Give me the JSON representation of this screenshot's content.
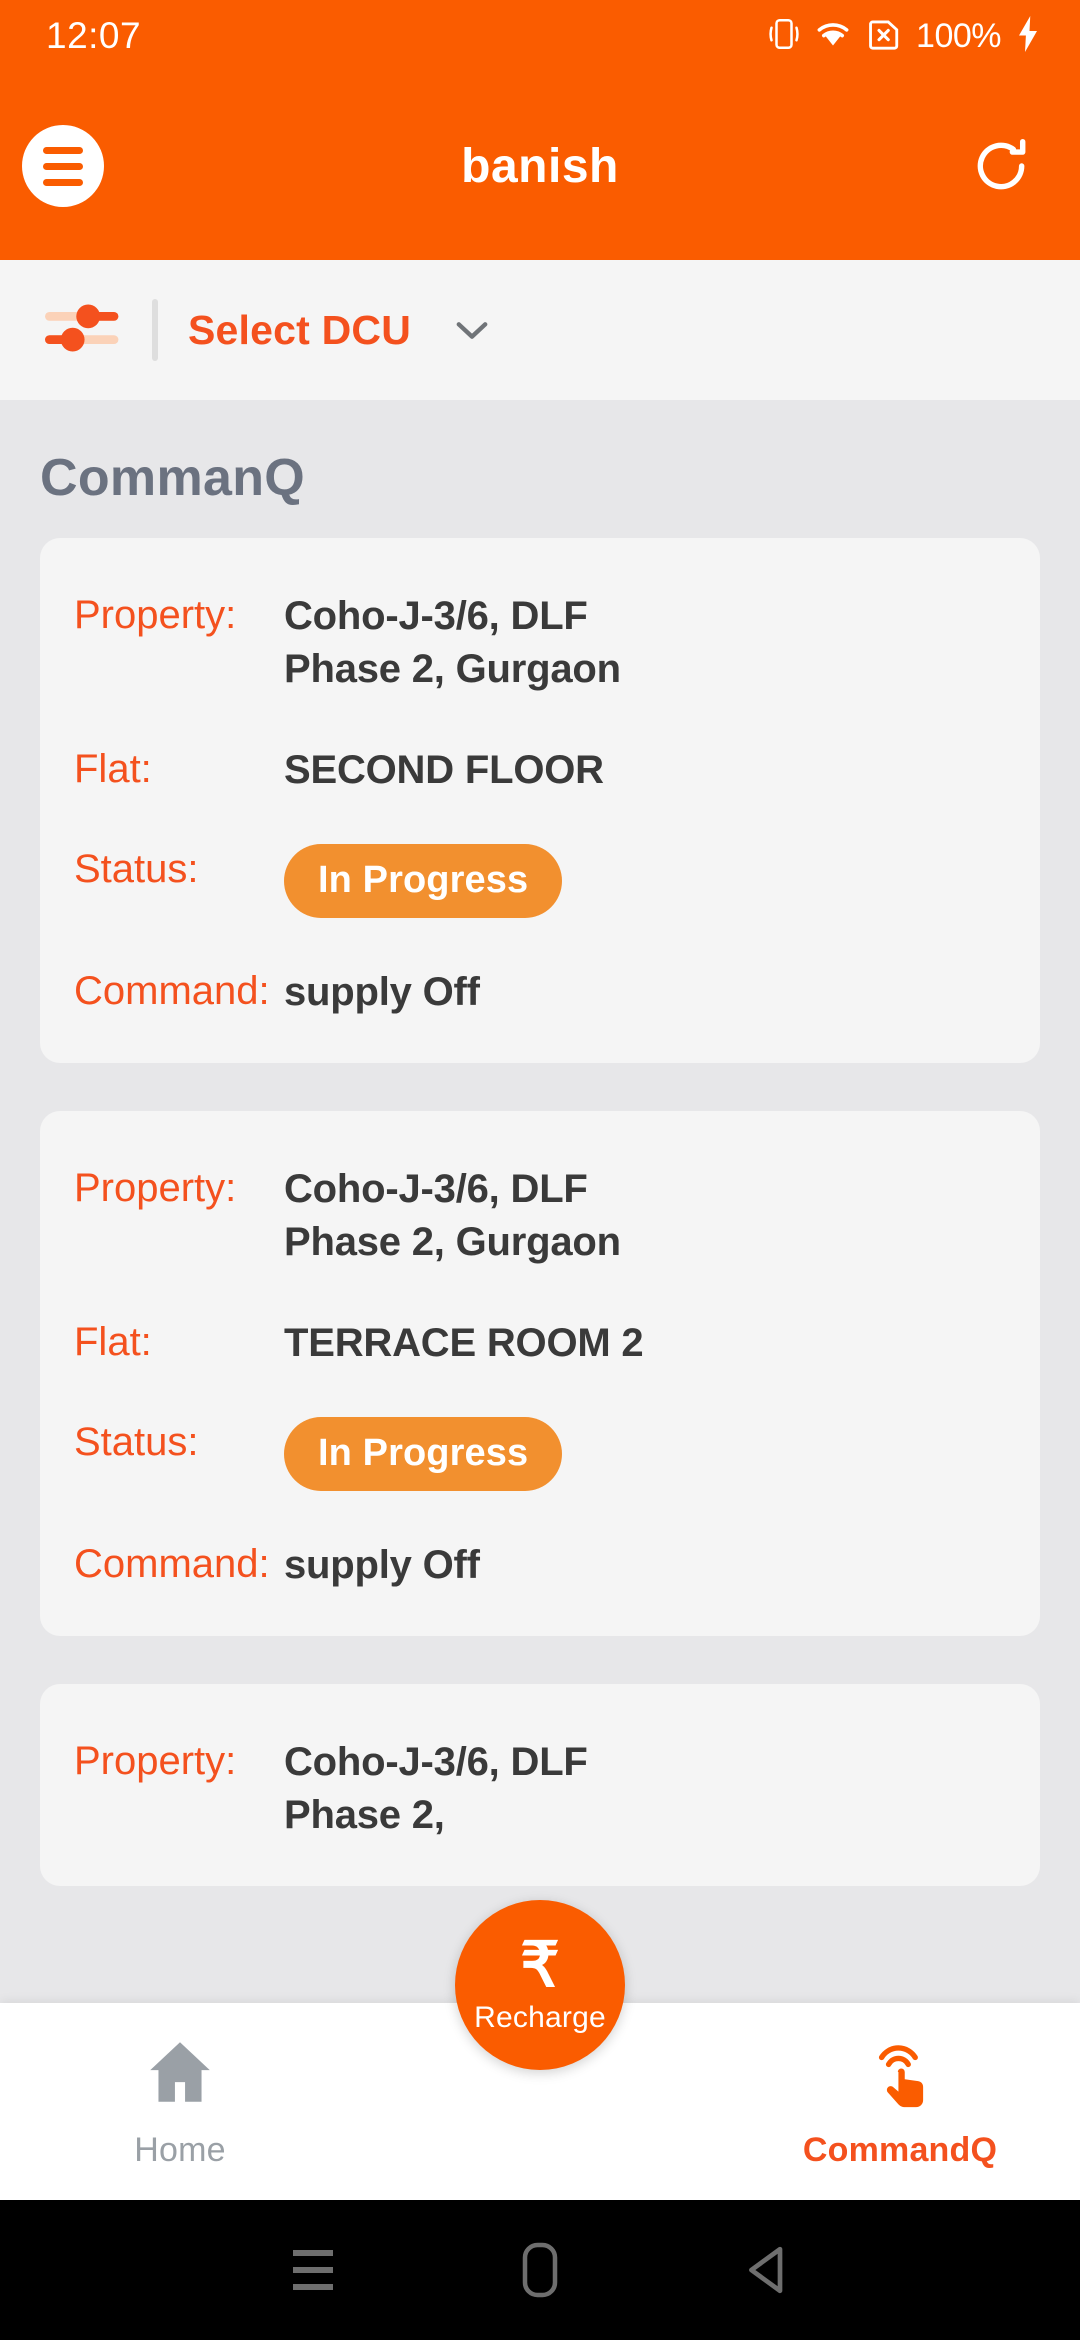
{
  "status_bar": {
    "time": "12:07",
    "battery_percent": "100%",
    "icons": [
      "vibrate-icon",
      "wifi-icon",
      "no-sim-icon",
      "charging-bolt-icon"
    ]
  },
  "app_bar": {
    "menu_icon": "hamburger-menu-icon",
    "title": "banish",
    "refresh_icon": "refresh-icon"
  },
  "dcu_bar": {
    "filter_icon": "sliders-filter-icon",
    "label": "Select DCU",
    "chevron_icon": "chevron-down-icon"
  },
  "main": {
    "page_title": "CommanQ",
    "labels": {
      "property": "Property:",
      "flat": "Flat:",
      "status": "Status:",
      "command": "Command:"
    },
    "cards": [
      {
        "property": "Coho-J-3/6, DLF Phase 2, Gurgaon",
        "flat": "SECOND FLOOR",
        "status": "In Progress",
        "command": "supply Off"
      },
      {
        "property": "Coho-J-3/6, DLF Phase 2, Gurgaon",
        "flat": "TERRACE ROOM 2",
        "status": "In Progress",
        "command": "supply Off"
      },
      {
        "property": "Coho-J-3/6, DLF Phase 2,",
        "flat": "",
        "status": "",
        "command": ""
      }
    ]
  },
  "bottom_nav": {
    "home_label": "Home",
    "home_icon": "home-icon",
    "recharge_label": "Recharge",
    "recharge_symbol": "₹",
    "commandq_label": "CommandQ",
    "commandq_icon": "tap-touch-icon"
  },
  "system_nav": {
    "recents_icon": "recents-icon",
    "home_icon": "home-pill-icon",
    "back_icon": "back-triangle-icon"
  },
  "colors": {
    "brand_orange": "#FA5C00",
    "label_orange": "#F4511E",
    "badge_orange": "#F2902F",
    "page_bg": "#E7E7E9",
    "card_bg": "#F5F5F5",
    "title_gray": "#6B7280"
  }
}
